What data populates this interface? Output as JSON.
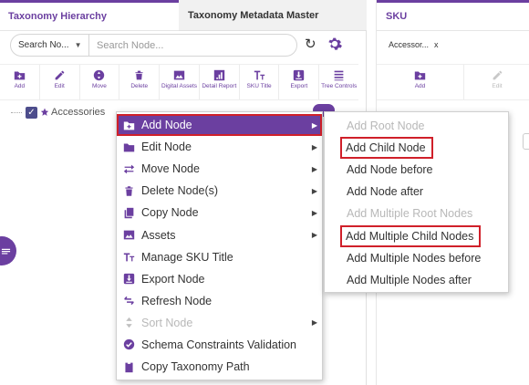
{
  "left_panel": {
    "tabs": [
      {
        "label": "Taxonomy Hierarchy",
        "active": true
      },
      {
        "label": "Taxonomy Metadata Master",
        "active": false
      }
    ],
    "search": {
      "scope": "Search No...",
      "placeholder": "Search Node..."
    },
    "toolbar": [
      {
        "label": "Add",
        "icon": "add-folder-icon"
      },
      {
        "label": "Edit",
        "icon": "pencil-icon"
      },
      {
        "label": "Move",
        "icon": "move-icon"
      },
      {
        "label": "Delete",
        "icon": "trash-icon"
      },
      {
        "label": "Digital Assets",
        "icon": "image-icon"
      },
      {
        "label": "Detail Report",
        "icon": "report-icon"
      },
      {
        "label": "SKU Title",
        "icon": "text-title-icon"
      },
      {
        "label": "Export",
        "icon": "export-icon"
      },
      {
        "label": "Tree Controls",
        "icon": "list-icon"
      }
    ],
    "tree": {
      "root_label": "Accessories"
    }
  },
  "right_panel": {
    "title": "SKU",
    "chip": {
      "label": "Accessor...",
      "close": "x"
    },
    "toolbar": [
      {
        "label": "Add",
        "icon": "add-folder-icon"
      },
      {
        "label": "Edit",
        "icon": "pencil-icon",
        "disabled": true
      }
    ]
  },
  "context_menu": {
    "items": [
      {
        "label": "Add Node",
        "icon": "add-folder-icon",
        "submenu": true,
        "active": true
      },
      {
        "label": "Edit Node",
        "icon": "folder-icon",
        "submenu": true
      },
      {
        "label": "Move Node",
        "icon": "swap-arrows-icon",
        "submenu": true
      },
      {
        "label": "Delete Node(s)",
        "icon": "trash-icon",
        "submenu": true
      },
      {
        "label": "Copy Node",
        "icon": "copy-icon",
        "submenu": true
      },
      {
        "label": "Assets",
        "icon": "image-icon",
        "submenu": true
      },
      {
        "label": "Manage SKU Title",
        "icon": "text-title-icon",
        "submenu": false
      },
      {
        "label": "Export Node",
        "icon": "export-icon",
        "submenu": false
      },
      {
        "label": "Refresh Node",
        "icon": "refresh-icon",
        "submenu": false
      },
      {
        "label": "Sort Node",
        "icon": "sort-icon",
        "submenu": true,
        "disabled": true
      },
      {
        "label": "Schema Constraints Validation",
        "icon": "check-circle-icon",
        "submenu": false
      },
      {
        "label": "Copy Taxonomy Path",
        "icon": "clipboard-icon",
        "submenu": false
      }
    ]
  },
  "submenu": {
    "items": [
      {
        "label": "Add Root Node",
        "disabled": true
      },
      {
        "label": "Add Child Node",
        "highlighted": true
      },
      {
        "label": "Add Node before"
      },
      {
        "label": "Add Node after"
      },
      {
        "label": "Add Multiple Root Nodes",
        "disabled": true
      },
      {
        "label": "Add Multiple Child Nodes",
        "highlighted": true
      },
      {
        "label": "Add Multiple Nodes before"
      },
      {
        "label": "Add Multiple Nodes after"
      }
    ]
  },
  "colors": {
    "accent": "#6b3fa0",
    "highlight_border": "#d0202a",
    "disabled_text": "#b8b8b8"
  }
}
